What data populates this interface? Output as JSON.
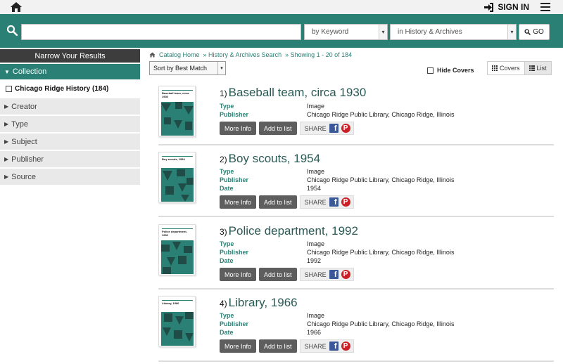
{
  "topbar": {
    "signin_label": "SIGN IN"
  },
  "search": {
    "query_value": "",
    "keyword_select": "by Keyword",
    "scope_select": "in History & Archives",
    "go_label": "GO"
  },
  "sidebar": {
    "header": "Narrow Your Results",
    "open_facet": {
      "label": "Collection",
      "values": [
        {
          "label": "Chicago Ridge History (184)"
        }
      ]
    },
    "facets": [
      {
        "label": "Creator"
      },
      {
        "label": "Type"
      },
      {
        "label": "Subject"
      },
      {
        "label": "Publisher"
      },
      {
        "label": "Source"
      }
    ]
  },
  "breadcrumb": {
    "home": "Catalog Home",
    "search": "» History & Archives Search",
    "showing": "» Showing 1 - 20 of 184"
  },
  "toolbar": {
    "sort_label": "Sort by Best Match",
    "hide_covers_label": "Hide Covers",
    "covers_label": "Covers",
    "list_label": "List"
  },
  "results": [
    {
      "num": "1)",
      "title": "Baseball team, circa 1930",
      "cover_title": "Baseball team, circa 1930",
      "fields": [
        {
          "label": "Type",
          "value": "Image"
        },
        {
          "label": "Publisher",
          "value": "Chicago Ridge Public Library, Chicago Ridge, Illinois"
        }
      ]
    },
    {
      "num": "2)",
      "title": "Boy scouts, 1954",
      "cover_title": "Boy scouts, 1954",
      "fields": [
        {
          "label": "Type",
          "value": "Image"
        },
        {
          "label": "Publisher",
          "value": "Chicago Ridge Public Library, Chicago Ridge, Illinois"
        },
        {
          "label": "Date",
          "value": "1954"
        }
      ]
    },
    {
      "num": "3)",
      "title": "Police department, 1992",
      "cover_title": "Police department, 1992",
      "fields": [
        {
          "label": "Type",
          "value": "Image"
        },
        {
          "label": "Publisher",
          "value": "Chicago Ridge Public Library, Chicago Ridge, Illinois"
        },
        {
          "label": "Date",
          "value": "1992"
        }
      ]
    },
    {
      "num": "4)",
      "title": "Library, 1966",
      "cover_title": "Library, 1966",
      "fields": [
        {
          "label": "Type",
          "value": "Image"
        },
        {
          "label": "Publisher",
          "value": "Chicago Ridge Public Library, Chicago Ridge, Illinois"
        },
        {
          "label": "Date",
          "value": "1966"
        }
      ]
    }
  ],
  "actions": {
    "more_info": "More Info",
    "add_to_list": "Add to list",
    "share": "SHARE",
    "fb": "f",
    "pin": "P"
  },
  "colors": {
    "accent": "#2a8075",
    "dark": "#3d3d3d",
    "button": "#5e5e5e"
  }
}
